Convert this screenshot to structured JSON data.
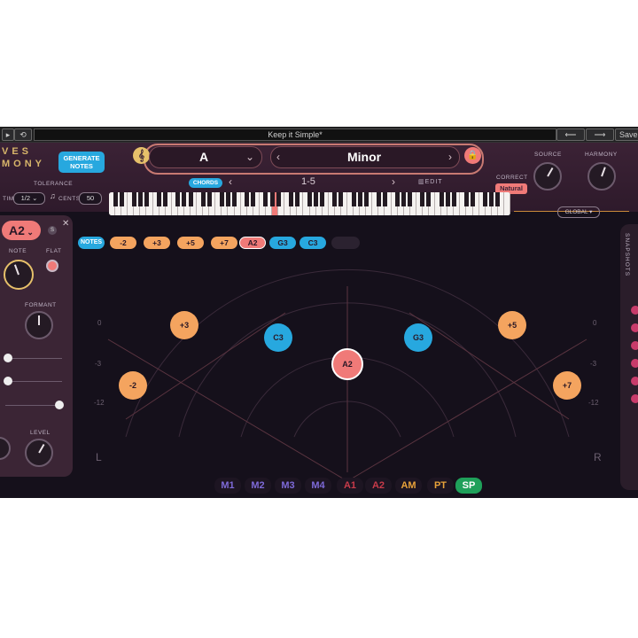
{
  "window": {
    "preset_name": "Keep it Simple*",
    "save_label": "Save"
  },
  "header": {
    "logo_top": "VES",
    "logo_bottom": "MONY",
    "generate_label_line1": "GENERATE",
    "generate_label_line2": "NOTES",
    "tolerance_label": "TOLERANCE",
    "time_label": "TIME",
    "time_value": "1/2",
    "cents_label": "CENTS",
    "cents_value": "50",
    "key": "A",
    "scale": "Minor",
    "chords_tab": "CHORDS",
    "chord_range": "1-5",
    "edit_label": "EDIT",
    "correct_label": "CORRECT",
    "correct_value": "Natural",
    "source_label": "SOURCE",
    "harmony_label": "HARMONY",
    "global_label": "GLOBAL"
  },
  "left_panel": {
    "voice": "A2",
    "solo_label": "S",
    "note_label": "NOTE",
    "flat_label": "FLAT",
    "formant_label": "FORMANT",
    "level_label": "LEVEL"
  },
  "notes_row": {
    "notes_label": "NOTES",
    "chips": [
      {
        "label": "-2",
        "color": "#f4a45f"
      },
      {
        "label": "+3",
        "color": "#f4a45f"
      },
      {
        "label": "+5",
        "color": "#f4a45f"
      },
      {
        "label": "+7",
        "color": "#f4a45f"
      },
      {
        "label": "A2",
        "color": "#f07a78"
      },
      {
        "label": "G3",
        "color": "#27a8df"
      },
      {
        "label": "C3",
        "color": "#27a8df"
      }
    ]
  },
  "stage": {
    "db_labels": [
      "0",
      "-3",
      "-12"
    ],
    "left_label": "L",
    "right_label": "R",
    "nodes": [
      {
        "label": "+3",
        "color": "#f4a45f"
      },
      {
        "label": "C3",
        "color": "#27a8df"
      },
      {
        "label": "A2",
        "color": "#f07a78"
      },
      {
        "label": "G3",
        "color": "#27a8df"
      },
      {
        "label": "+5",
        "color": "#f4a45f"
      },
      {
        "label": "-2",
        "color": "#f4a45f"
      },
      {
        "label": "+7",
        "color": "#f4a45f"
      }
    ]
  },
  "modes": [
    {
      "label": "M1",
      "color": "#7e6ad8"
    },
    {
      "label": "M2",
      "color": "#7e6ad8"
    },
    {
      "label": "M3",
      "color": "#7e6ad8"
    },
    {
      "label": "M4",
      "color": "#7e6ad8"
    },
    {
      "label": "A1",
      "color": "#c83b4a"
    },
    {
      "label": "A2",
      "color": "#c83b4a"
    },
    {
      "label": "AM",
      "color": "#e8a23a"
    },
    {
      "label": "PT",
      "color": "#e8a23a"
    },
    {
      "label": "SP",
      "color": "#ffffff"
    }
  ],
  "snapshots": {
    "label": "SNAPSHOTS"
  }
}
